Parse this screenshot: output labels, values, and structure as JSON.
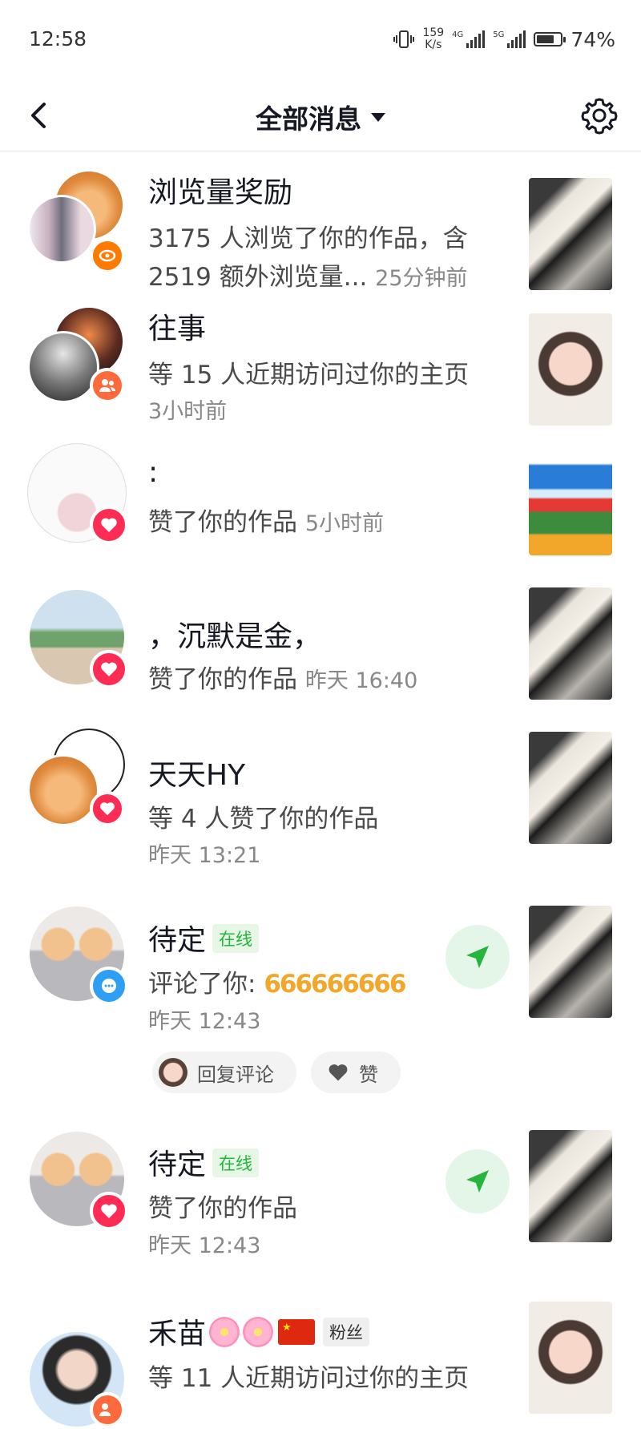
{
  "status_bar": {
    "time": "12:58",
    "net_speed_value": "159",
    "net_speed_unit": "K/s",
    "sim1_label": "4G",
    "sim2_label": "5G",
    "battery_percent": "74%",
    "battery_level": 0.74
  },
  "header": {
    "title": "全部消息"
  },
  "messages": [
    {
      "name": "浏览量奖励",
      "line1": "3175 人浏览了你的作品，含",
      "line2": "2519 额外浏览量...",
      "time": "25分钟前",
      "badge": "eye-icon"
    },
    {
      "name": "往事",
      "line1": "等 15 人近期访问过你的主页",
      "time": "3小时前",
      "badge": "users-icon"
    },
    {
      "name": ":",
      "line1": "赞了你的作品",
      "time": "5小时前",
      "badge": "heart-icon"
    },
    {
      "name": "，沉默是金，",
      "line1": "赞了你的作品",
      "time": "昨天 16:40",
      "badge": "heart-icon"
    },
    {
      "name": "天天HY",
      "line1": "等 4 人赞了你的作品",
      "time": "昨天 13:21",
      "badge": "heart-icon"
    },
    {
      "name": "待定",
      "online_label": "在线",
      "line1": "评论了你: ",
      "comment_emoji": "666666666",
      "time": "昨天 12:43",
      "badge": "comment-icon",
      "reply_label": "回复评论",
      "like_label": "赞"
    },
    {
      "name": "待定",
      "online_label": "在线",
      "line1": "赞了你的作品",
      "time": "昨天 12:43",
      "badge": "heart-icon"
    },
    {
      "name": "禾苗",
      "fan_label": "粉丝",
      "line1": "等 11 人近期访问过你的主页",
      "badge": "users-icon"
    }
  ],
  "colors": {
    "heart_badge": "#fe2c55",
    "online_green": "#25b43d",
    "eye_badge": "#ff7a00"
  }
}
